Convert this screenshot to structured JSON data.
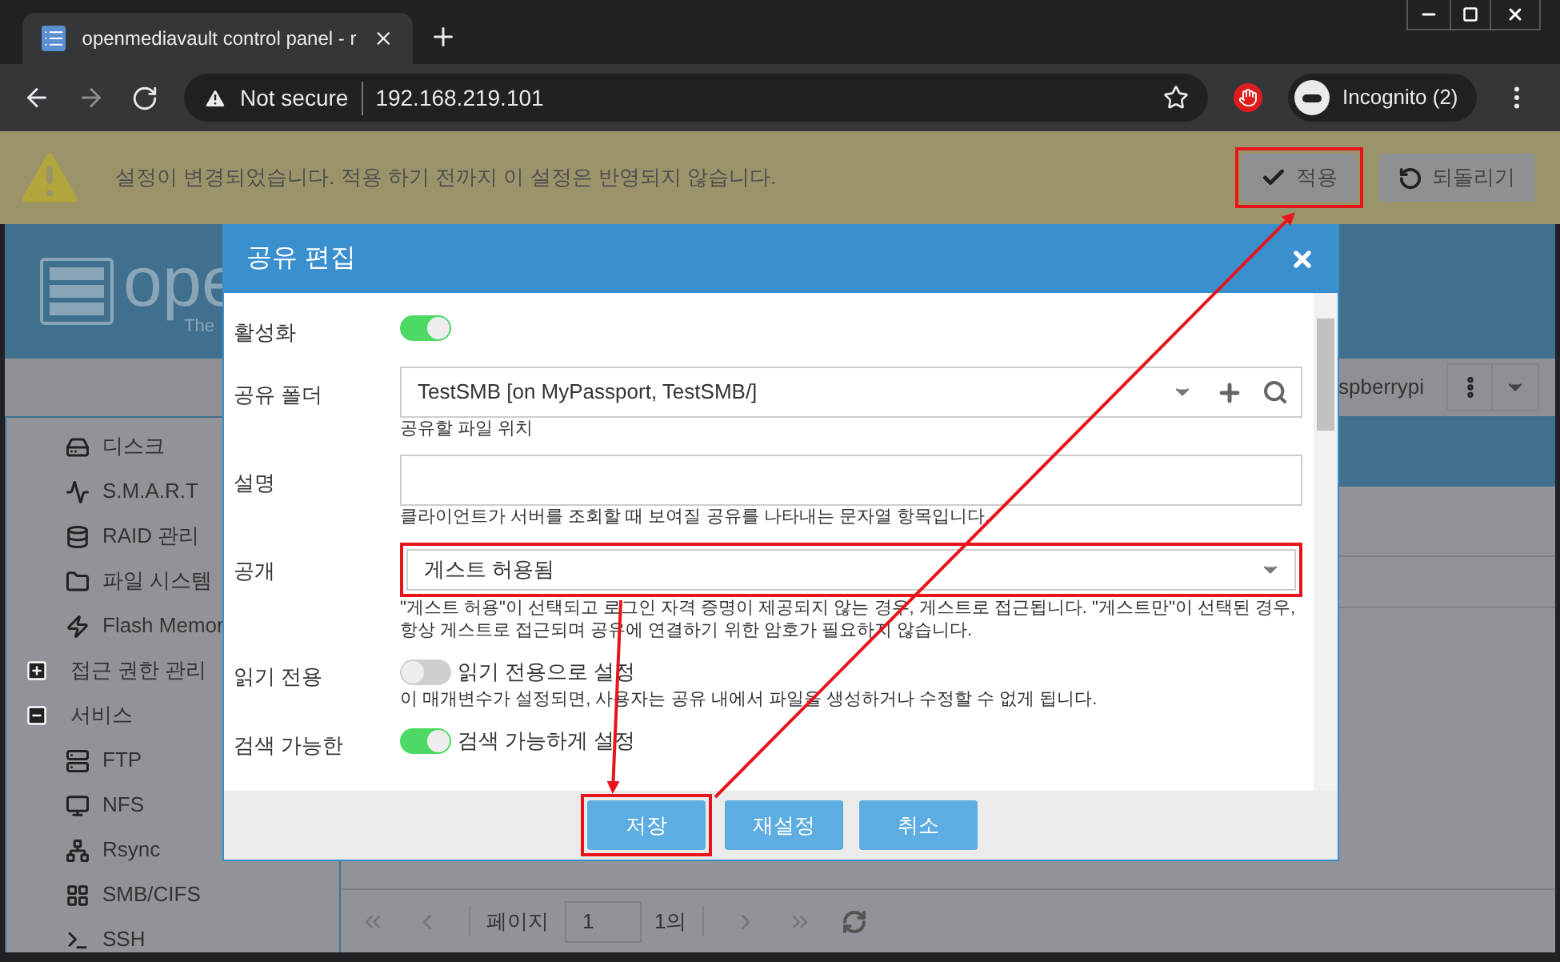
{
  "browser": {
    "tab_title": "openmediavault control panel - r",
    "security": "Not secure",
    "url": "192.168.219.101",
    "profile": "Incognito (2)"
  },
  "notice": {
    "message": "설정이 변경되었습니다. 적용 하기 전까지 이 설정은 반영되지 않습니다.",
    "buttons": [
      {
        "label": "적용",
        "highlighted": true
      },
      {
        "label": "되돌리기",
        "highlighted": false
      }
    ]
  },
  "background": {
    "logo": "ope",
    "tagline": "The",
    "host": "spberrypi",
    "sidebar": {
      "items": [
        {
          "kind": "leaf",
          "label": "디스크"
        },
        {
          "kind": "leaf",
          "label": "S.M.A.R.T"
        },
        {
          "kind": "leaf",
          "label": "RAID 관리"
        },
        {
          "kind": "leaf",
          "label": "파일 시스템"
        },
        {
          "kind": "leaf",
          "label": "Flash Memor"
        },
        {
          "kind": "group",
          "label": "접근 권한 관리",
          "expanded": false
        },
        {
          "kind": "group",
          "label": "서비스",
          "expanded": true,
          "children": [
            {
              "kind": "leaf",
              "label": "FTP"
            },
            {
              "kind": "leaf",
              "label": "NFS"
            },
            {
              "kind": "leaf",
              "label": "Rsync"
            },
            {
              "kind": "leaf",
              "label": "SMB/CIFS"
            },
            {
              "kind": "leaf",
              "label": "SSH"
            }
          ]
        }
      ]
    },
    "pager": {
      "page_label": "페이지",
      "page_value": "1",
      "of_label": "1의"
    }
  },
  "dialog": {
    "title": "공유 편집",
    "fields": [
      {
        "kind": "toggle",
        "label": "활성화",
        "on": true
      },
      {
        "kind": "select",
        "label": "공유 폴더",
        "value": "TestSMB [on MyPassport, TestSMB/]",
        "hint": "공유할 파일 위치",
        "actions": true,
        "highlighted": false
      },
      {
        "kind": "text",
        "label": "설명",
        "hint": "클라이언트가 서버를 조회할 때 보여질 공유를 나타내는 문자열 항목입니다."
      },
      {
        "kind": "select",
        "label": "공개",
        "value": "게스트 허용됨",
        "hint": "\"게스트 허용\"이 선택되고 로그인 자격 증명이 제공되지 않는 경우, 게스트로 접근됩니다. \"게스트만\"이 선택된 경우, 항상 게스트로 접근되며 공유에 연결하기 위한 암호가 필요하지 않습니다.",
        "actions": false,
        "highlighted": true
      },
      {
        "kind": "toggle",
        "label": "읽기 전용",
        "on": false,
        "caption": "읽기 전용으로 설정",
        "hint": "이 매개변수가 설정되면, 사용자는 공유 내에서 파일을 생성하거나 수정할 수 없게 됩니다."
      },
      {
        "kind": "toggle",
        "label": "검색 가능한",
        "on": true,
        "caption": "검색 가능하게 설정"
      }
    ],
    "buttons": [
      {
        "label": "저장",
        "highlighted": true
      },
      {
        "label": "재설정",
        "highlighted": false
      },
      {
        "label": "취소",
        "highlighted": false
      }
    ]
  }
}
